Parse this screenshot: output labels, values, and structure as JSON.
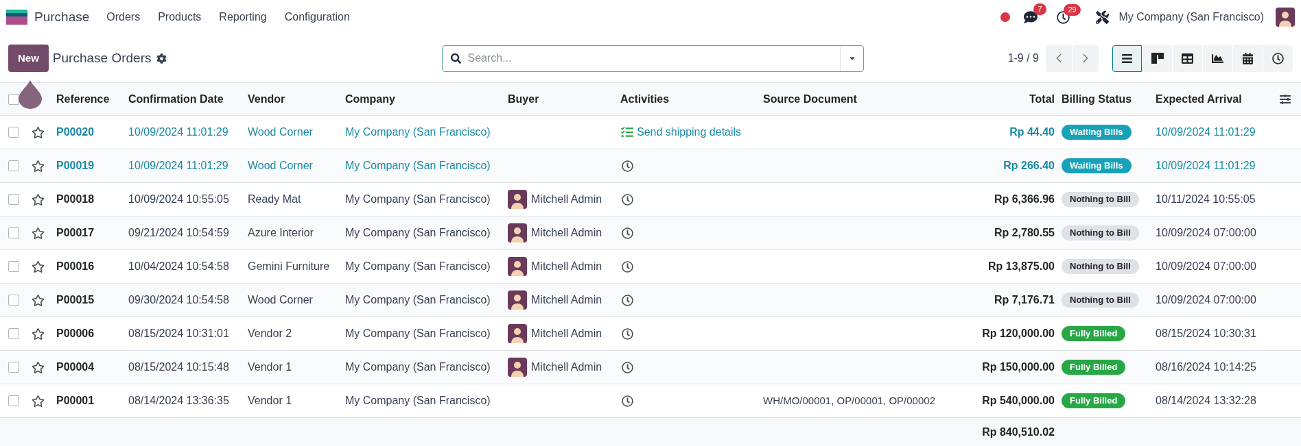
{
  "navbar": {
    "app_name": "Purchase",
    "menus": [
      "Orders",
      "Products",
      "Reporting",
      "Configuration"
    ],
    "messages_count": "7",
    "activities_count": "29",
    "company": "My Company (San Francisco)"
  },
  "control_panel": {
    "new_button": "New",
    "title": "Purchase Orders",
    "search": {
      "placeholder": "Search..."
    },
    "pager": "1-9 / 9",
    "views": [
      {
        "kind": "list",
        "selected": true
      },
      {
        "kind": "kanban",
        "selected": false
      },
      {
        "kind": "pivot",
        "selected": false
      },
      {
        "kind": "graph",
        "selected": false
      },
      {
        "kind": "calendar",
        "selected": false
      },
      {
        "kind": "activity",
        "selected": false
      }
    ]
  },
  "table": {
    "select_all_checked": false,
    "columns": [
      "Reference",
      "Confirmation Date",
      "Vendor",
      "Company",
      "Buyer",
      "Activities",
      "Source Document",
      "Total",
      "Billing Status",
      "Expected Arrival"
    ],
    "rows": [
      {
        "kind": "highlight",
        "checked": false,
        "starred": false,
        "reference": "P00020",
        "confirmation_date": "10/09/2024 11:01:29",
        "vendor": "Wood Corner",
        "company": "My Company (San Francisco)",
        "activity": {
          "kind": "todo",
          "label": "Send shipping details"
        },
        "total": "Rp 44.40",
        "billing_status": {
          "label": "Waiting Bills",
          "kind": "info"
        },
        "expected_arrival": "10/09/2024 11:01:29"
      },
      {
        "kind": "highlight",
        "checked": false,
        "starred": false,
        "reference": "P00019",
        "confirmation_date": "10/09/2024 11:01:29",
        "vendor": "Wood Corner",
        "company": "My Company (San Francisco)",
        "activity": {
          "kind": "none"
        },
        "total": "Rp 266.40",
        "billing_status": {
          "label": "Waiting Bills",
          "kind": "info"
        },
        "expected_arrival": "10/09/2024 11:01:29"
      },
      {
        "kind": "normal",
        "checked": false,
        "starred": false,
        "reference": "P00018",
        "confirmation_date": "10/09/2024 10:55:05",
        "vendor": "Ready Mat",
        "company": "My Company (San Francisco)",
        "buyer": "Mitchell Admin",
        "activity": {
          "kind": "none"
        },
        "total": "Rp 6,366.96",
        "billing_status": {
          "label": "Nothing to Bill",
          "kind": "muted"
        },
        "expected_arrival": "10/11/2024 10:55:05"
      },
      {
        "kind": "normal",
        "checked": false,
        "starred": false,
        "reference": "P00017",
        "confirmation_date": "09/21/2024 10:54:59",
        "vendor": "Azure Interior",
        "company": "My Company (San Francisco)",
        "buyer": "Mitchell Admin",
        "activity": {
          "kind": "none"
        },
        "total": "Rp 2,780.55",
        "billing_status": {
          "label": "Nothing to Bill",
          "kind": "muted"
        },
        "expected_arrival": "10/09/2024 07:00:00"
      },
      {
        "kind": "normal",
        "checked": false,
        "starred": false,
        "reference": "P00016",
        "confirmation_date": "10/04/2024 10:54:58",
        "vendor": "Gemini Furniture",
        "company": "My Company (San Francisco)",
        "buyer": "Mitchell Admin",
        "activity": {
          "kind": "none"
        },
        "total": "Rp 13,875.00",
        "billing_status": {
          "label": "Nothing to Bill",
          "kind": "muted"
        },
        "expected_arrival": "10/09/2024 07:00:00"
      },
      {
        "kind": "normal",
        "checked": false,
        "starred": false,
        "reference": "P00015",
        "confirmation_date": "09/30/2024 10:54:58",
        "vendor": "Wood Corner",
        "company": "My Company (San Francisco)",
        "buyer": "Mitchell Admin",
        "activity": {
          "kind": "none"
        },
        "total": "Rp 7,176.71",
        "billing_status": {
          "label": "Nothing to Bill",
          "kind": "muted"
        },
        "expected_arrival": "10/09/2024 07:00:00"
      },
      {
        "kind": "normal",
        "checked": false,
        "starred": false,
        "reference": "P00006",
        "confirmation_date": "08/15/2024 10:31:01",
        "vendor": "Vendor 2",
        "company": "My Company (San Francisco)",
        "buyer": "Mitchell Admin",
        "activity": {
          "kind": "none"
        },
        "total": "Rp 120,000.00",
        "billing_status": {
          "label": "Fully Billed",
          "kind": "success"
        },
        "expected_arrival": "08/15/2024 10:30:31"
      },
      {
        "kind": "normal",
        "checked": false,
        "starred": false,
        "reference": "P00004",
        "confirmation_date": "08/15/2024 10:15:48",
        "vendor": "Vendor 1",
        "company": "My Company (San Francisco)",
        "buyer": "Mitchell Admin",
        "activity": {
          "kind": "none"
        },
        "total": "Rp 150,000.00",
        "billing_status": {
          "label": "Fully Billed",
          "kind": "success"
        },
        "expected_arrival": "08/16/2024 10:14:25"
      },
      {
        "kind": "normal",
        "checked": false,
        "starred": false,
        "reference": "P00001",
        "confirmation_date": "08/14/2024 13:36:35",
        "vendor": "Vendor 1",
        "company": "My Company (San Francisco)",
        "activity": {
          "kind": "none"
        },
        "source_document": "WH/MO/00001, OP/00001, OP/00002",
        "total": "Rp 540,000.00",
        "billing_status": {
          "label": "Fully Billed",
          "kind": "success"
        },
        "expected_arrival": "08/14/2024 13:32:28"
      }
    ],
    "grand_total": "Rp 840,510.02"
  }
}
